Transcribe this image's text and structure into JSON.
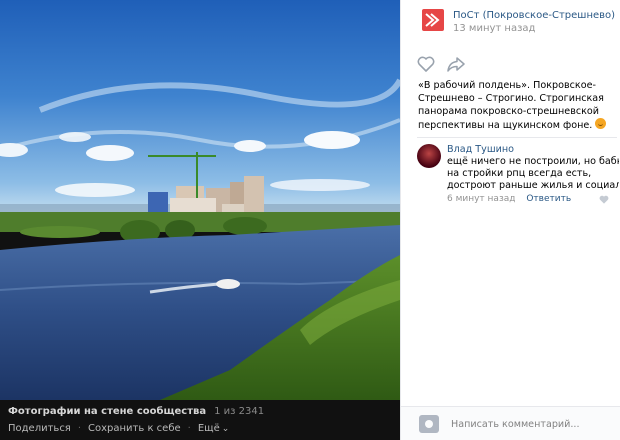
{
  "viewer": {
    "album_title": "Фотографии на стене сообщества",
    "counter": "1 из 2341",
    "actions": {
      "share": "Поделиться",
      "save": "Сохранить к себе",
      "more": "Ещё"
    }
  },
  "post": {
    "group_name": "ПоСт (Покровское-Стрешнево)",
    "time": "13 минут назад",
    "text_lines": [
      "«В рабочий полдень». Покровское-",
      "Стрешнево – Строгино. Строгинская",
      "панорама покровско-стрешневской",
      "перспективы на щукинском фоне."
    ],
    "brand_color": "#e64646",
    "link_color": "#2a5885"
  },
  "comment": {
    "author": "Влад Тушино",
    "lines": [
      "ещё ничего не построили, но бабки",
      "на стройки рпц всегда есть,",
      "достроют раньше жилья и социалки("
    ],
    "time": "6 минут назад",
    "reply": "Ответить"
  },
  "composer": {
    "placeholder": "Написать комментарий..."
  }
}
